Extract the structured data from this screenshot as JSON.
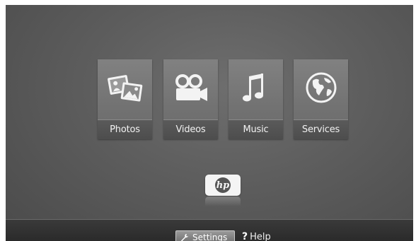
{
  "menu": {
    "tiles": [
      {
        "label": "Photos",
        "icon": "photos-icon"
      },
      {
        "label": "Videos",
        "icon": "video-camera-icon"
      },
      {
        "label": "Music",
        "icon": "music-note-icon"
      },
      {
        "label": "Services",
        "icon": "globe-icon"
      }
    ]
  },
  "brand": {
    "logo_text": "hp",
    "logo_color": "#f4f4f4"
  },
  "bottom_bar": {
    "settings_label": "Settings",
    "settings_icon": "wrench-icon",
    "help_symbol": "?",
    "help_label": "Help"
  },
  "colors": {
    "background": "#5f5f5f",
    "tile": "#7a7a7a",
    "tile_label_bar": "#525252",
    "bottom_bar": "#2f2f2f"
  }
}
